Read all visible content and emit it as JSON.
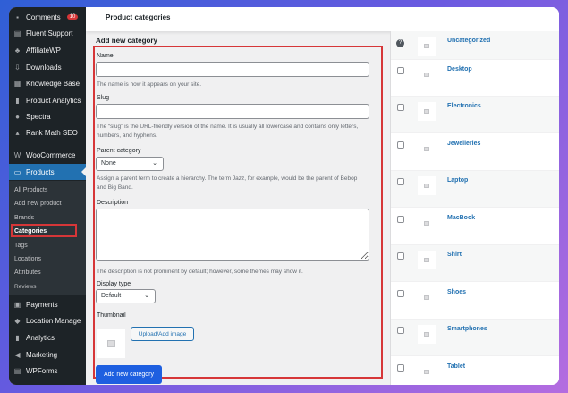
{
  "sidebar": {
    "top_items": [
      {
        "label": "Comments",
        "icon": "comment-icon",
        "badge": "10"
      },
      {
        "label": "Fluent Support",
        "icon": "support-icon"
      },
      {
        "label": "AffiliateWP",
        "icon": "affiliate-icon"
      },
      {
        "label": "Downloads",
        "icon": "download-icon"
      },
      {
        "label": "Knowledge Base",
        "icon": "book-icon"
      },
      {
        "label": "Product Analytics",
        "icon": "bar-chart-icon"
      },
      {
        "label": "Spectra",
        "icon": "spectra-icon"
      },
      {
        "label": "Rank Math SEO",
        "icon": "rankmath-icon"
      }
    ],
    "woocommerce": "WooCommerce",
    "products": "Products",
    "submenu": [
      "All Products",
      "Add new product",
      "Brands",
      "Categories",
      "Tags",
      "Locations",
      "Attributes",
      "Reviews"
    ],
    "bottom_items": [
      {
        "label": "Payments",
        "icon": "payment-icon"
      },
      {
        "label": "Location Manage",
        "icon": "location-icon"
      },
      {
        "label": "Analytics",
        "icon": "analytics-icon"
      },
      {
        "label": "Marketing",
        "icon": "megaphone-icon"
      },
      {
        "label": "WPForms",
        "icon": "forms-icon"
      }
    ]
  },
  "header": {
    "title": "Product categories"
  },
  "form": {
    "heading": "Add new category",
    "name_label": "Name",
    "name_value": "",
    "name_help": "The name is how it appears on your site.",
    "slug_label": "Slug",
    "slug_value": "",
    "slug_help": "The “slug” is the URL-friendly version of the name. It is usually all lowercase and contains only letters, numbers, and hyphens.",
    "parent_label": "Parent category",
    "parent_value": "None",
    "parent_help": "Assign a parent term to create a hierarchy. The term Jazz, for example, would be the parent of Bebop and Big Band.",
    "desc_label": "Description",
    "desc_value": "",
    "desc_help": "The description is not prominent by default; however, some themes may show it.",
    "display_label": "Display type",
    "display_value": "Default",
    "thumb_label": "Thumbnail",
    "upload_label": "Upload/Add image",
    "submit_label": "Add new category"
  },
  "categories": [
    "Uncategorized",
    "Desktop",
    "Electronics",
    "Jewelleries",
    "Laptop",
    "MacBook",
    "Shirt",
    "Shoes",
    "Smartphones",
    "Tablet"
  ]
}
